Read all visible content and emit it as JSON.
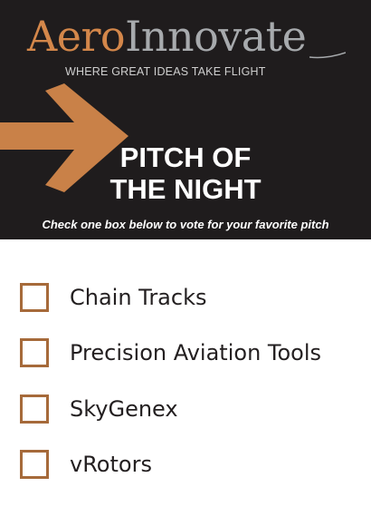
{
  "header": {
    "logo_part1": "Aero",
    "logo_part2": "Innovate",
    "tagline": "WHERE GREAT IDEAS TAKE FLIGHT",
    "title_line1": "PITCH OF",
    "title_line2": "THE NIGHT",
    "instructions": "Check one box below to vote for your favorite pitch"
  },
  "ballot": {
    "options": [
      {
        "label": "Chain Tracks",
        "checked": false
      },
      {
        "label": "Precision Aviation Tools",
        "checked": false
      },
      {
        "label": "SkyGenex",
        "checked": false
      },
      {
        "label": "vRotors",
        "checked": false
      }
    ]
  },
  "colors": {
    "header_background": "#1f1c1d",
    "accent_orange": "#d4874a",
    "logo_gray": "#a7aaad",
    "checkbox_border": "#a66a3a"
  },
  "icons": {
    "arrow": "right-arrow-icon",
    "checkbox": "checkbox-icon"
  }
}
